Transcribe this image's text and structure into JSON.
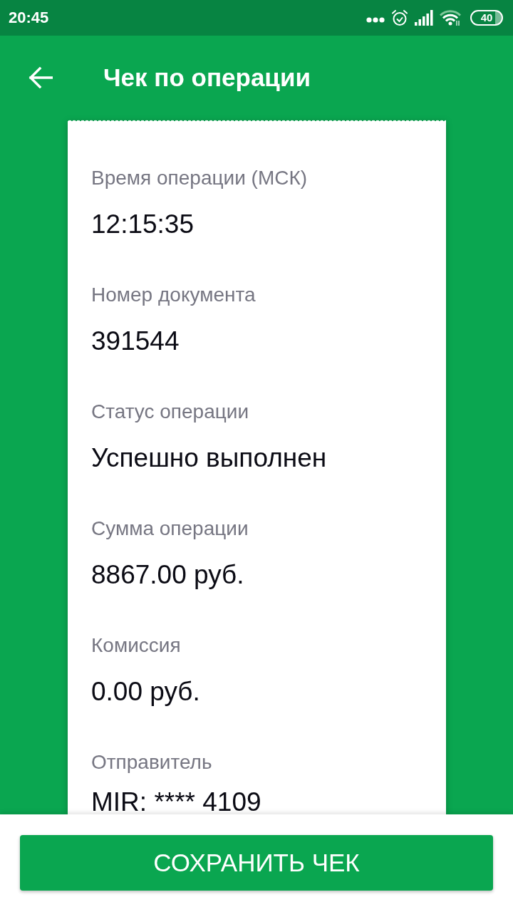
{
  "status_bar": {
    "time": "20:45",
    "battery": "40"
  },
  "header": {
    "title": "Чек по операции"
  },
  "receipt": {
    "fields": [
      {
        "label": "Время операции (МСК)",
        "value": "12:15:35"
      },
      {
        "label": "Номер документа",
        "value": "391544"
      },
      {
        "label": "Статус операции",
        "value": "Успешно выполнен"
      },
      {
        "label": "Сумма операции",
        "value": "8867.00 руб."
      },
      {
        "label": "Комиссия",
        "value": "0.00 руб."
      },
      {
        "label": "Отправитель",
        "value": "MIR: **** 4109"
      }
    ]
  },
  "save_button": {
    "label": "СОХРАНИТЬ ЧЕК"
  }
}
